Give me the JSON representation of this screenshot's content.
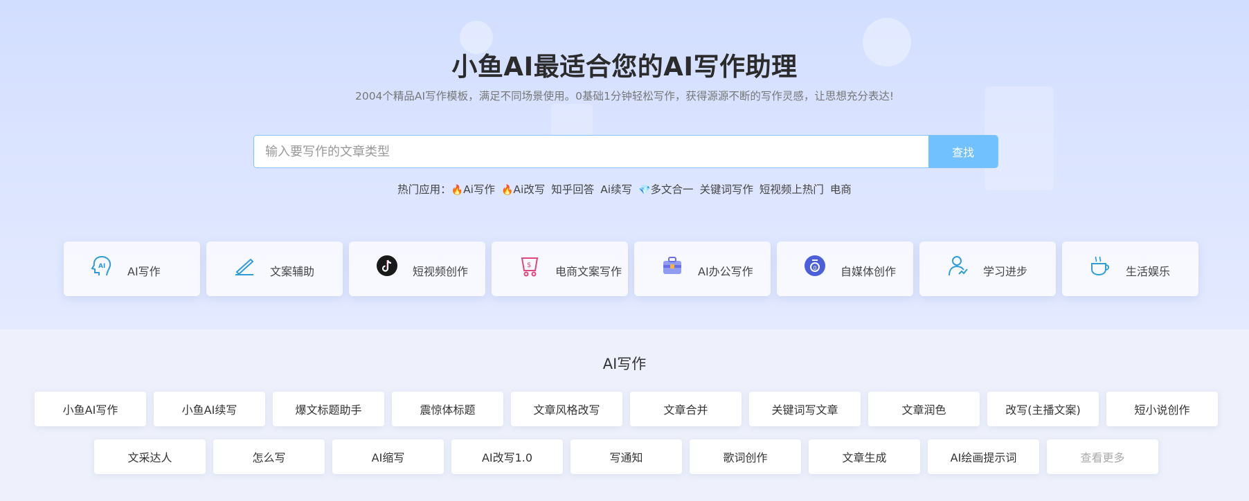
{
  "hero": {
    "title": "小鱼AI最适合您的AI写作助理",
    "subtitle": "2004个精品AI写作模板，满足不同场景使用。0基础1分钟轻松写作，获得源源不断的写作灵感，让思想充分表达!"
  },
  "search": {
    "placeholder": "输入要写作的文章类型",
    "value": "",
    "button_label": "查找"
  },
  "hot_apps": {
    "label": "热门应用：",
    "items": [
      {
        "icon": "fire-icon",
        "text": "Ai写作"
      },
      {
        "icon": "fire-icon",
        "text": "Ai改写"
      },
      {
        "icon": "",
        "text": "知乎回答"
      },
      {
        "icon": "",
        "text": "Ai续写"
      },
      {
        "icon": "diamond-icon",
        "text": "多文合一"
      },
      {
        "icon": "",
        "text": "关键词写作"
      },
      {
        "icon": "",
        "text": "短视频上热门"
      },
      {
        "icon": "",
        "text": "电商"
      }
    ]
  },
  "categories": [
    {
      "label": "AI写作",
      "icon": "ai-head-icon",
      "color": "#2f9bd9"
    },
    {
      "label": "文案辅助",
      "icon": "pen-icon",
      "color": "#2f9bd9"
    },
    {
      "label": "短视频创作",
      "icon": "tiktok-icon",
      "color": "#1a1a1a"
    },
    {
      "label": "电商文案写作",
      "icon": "shopping-bag-icon",
      "color": "#e0457b"
    },
    {
      "label": "AI办公写作",
      "icon": "briefcase-icon",
      "color": "#6b6ee8"
    },
    {
      "label": "自媒体创作",
      "icon": "media-badge-icon",
      "color": "#4a5fd9"
    },
    {
      "label": "学习进步",
      "icon": "person-icon",
      "color": "#2f9bd9"
    },
    {
      "label": "生活娱乐",
      "icon": "coffee-cup-icon",
      "color": "#2f9bd9"
    }
  ],
  "section": {
    "title": "AI写作"
  },
  "templates_row1": [
    "小鱼AI写作",
    "小鱼AI续写",
    "爆文标题助手",
    "震惊体标题",
    "文章风格改写",
    "文章合并",
    "关键词写文章",
    "文章润色",
    "改写(主播文案)",
    "短小说创作"
  ],
  "templates_row2": [
    "文采达人",
    "怎么写",
    "AI缩写",
    "AI改写1.0",
    "写通知",
    "歌词创作",
    "文章生成",
    "AI绘画提示词",
    "查看更多"
  ],
  "colors": {
    "accent": "#72c1ff",
    "search_border": "#7ec3ff",
    "hero_bg": "#d8e2ff"
  }
}
